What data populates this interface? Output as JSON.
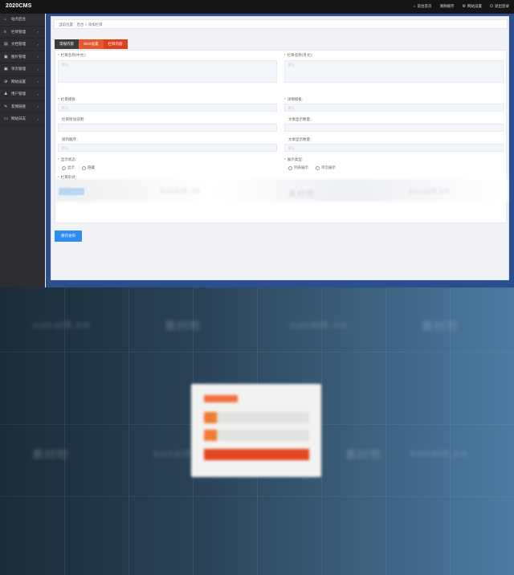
{
  "app": {
    "logo": "2020CMS"
  },
  "topnav": [
    {
      "icon": "home-icon",
      "glyph": "⌂",
      "label": "前台首页"
    },
    {
      "icon": "none",
      "glyph": "",
      "label": "清除缓存"
    },
    {
      "icon": "gear-icon",
      "glyph": "⚙",
      "label": "网站设置"
    },
    {
      "icon": "power-icon",
      "glyph": "⏻",
      "label": "退出登录"
    }
  ],
  "sidebar": [
    {
      "icon": "home-icon",
      "glyph": "⌂",
      "label": "站点后台",
      "arrow": ""
    },
    {
      "icon": "list-icon",
      "glyph": "≡",
      "label": "栏目管理",
      "arrow": "›"
    },
    {
      "icon": "file-icon",
      "glyph": "▤",
      "label": "文档管理",
      "arrow": "›"
    },
    {
      "icon": "image-icon",
      "glyph": "▣",
      "label": "图片管理",
      "arrow": "›"
    },
    {
      "icon": "image-icon",
      "glyph": "▣",
      "label": "单页管理",
      "arrow": "›"
    },
    {
      "icon": "gear-icon",
      "glyph": "⚙",
      "label": "网站设置",
      "arrow": "›"
    },
    {
      "icon": "user-icon",
      "glyph": "♟",
      "label": "用户管理",
      "arrow": "›"
    },
    {
      "icon": "wrench-icon",
      "glyph": "✎",
      "label": "友情链接",
      "arrow": "›"
    },
    {
      "icon": "log-icon",
      "glyph": "▭",
      "label": "网站日志",
      "arrow": "›"
    }
  ],
  "breadcrumb": "当前位置：后台 > 添加栏目",
  "tabs": [
    {
      "label": "常规内容"
    },
    {
      "label": "SEO设置"
    },
    {
      "label": "栏目内容"
    }
  ],
  "form": {
    "column_name_label": "栏目名称(中文)：",
    "column_name_en_label": "栏目名称(英文)：",
    "template_label": "栏目模板：",
    "detail_template_label": "详情模板：",
    "alias_label": "栏目附加说明：",
    "per_page_label": "文章显示数量：",
    "sort_label": "排列顺序：",
    "per_page2_label": "文章显示数量：",
    "display_status_label": "显示状态：",
    "display_type_label": "展示类型：",
    "column_image_label": "栏目形式：",
    "status_options": [
      "显示",
      "隐藏"
    ],
    "type_options": [
      "列表展示",
      "单页展示"
    ],
    "placeholder": "默认"
  },
  "save_button": "保存发布",
  "watermarks": [
    "sucai8.cn",
    "素材吧",
    "sucai8.cn",
    "素材吧"
  ]
}
